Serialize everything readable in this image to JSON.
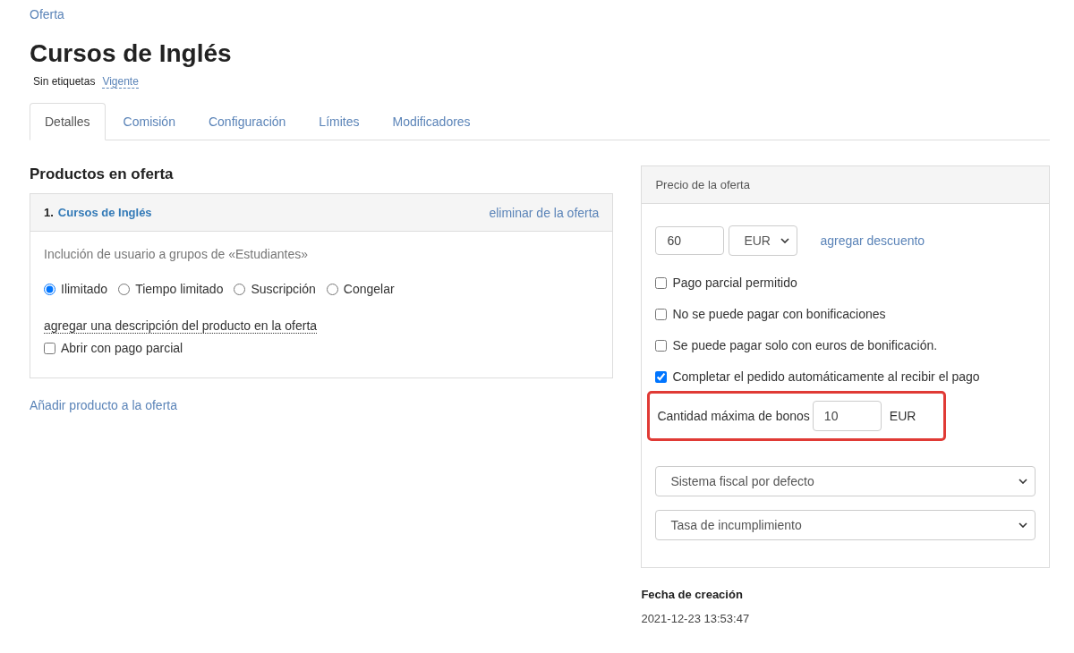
{
  "breadcrumb": "Oferta",
  "title": "Cursos de Inglés",
  "tags_label": "Sin etiquetas",
  "status": "Vigente",
  "tabs": [
    {
      "label": "Detalles",
      "selected": true
    },
    {
      "label": "Comisión",
      "selected": false
    },
    {
      "label": "Configuración",
      "selected": false
    },
    {
      "label": "Límites",
      "selected": false
    },
    {
      "label": "Modificadores",
      "selected": false
    }
  ],
  "products": {
    "heading": "Productos en oferta",
    "items": [
      {
        "number": "1.",
        "name": "Cursos de Inglés",
        "remove": "eliminar de la oferta",
        "description": "Inclución de usuario a grupos de «Estudiantes»",
        "access_options": [
          {
            "label": "Ilimitado",
            "selected": true
          },
          {
            "label": "Tiempo limitado",
            "selected": false
          },
          {
            "label": "Suscripción",
            "selected": false
          },
          {
            "label": "Congelar",
            "selected": false
          }
        ],
        "add_description": "agregar una descripción del producto en la oferta",
        "partial_open": {
          "label": "Abrir con pago parcial",
          "checked": false
        }
      }
    ],
    "add_product": "Añadir producto a la oferta"
  },
  "price": {
    "header": "Precio de la oferta",
    "amount": "60",
    "currency": "EUR",
    "discount_link": "agregar descuento",
    "options": [
      {
        "label": "Pago parcial permitido",
        "checked": false
      },
      {
        "label": "No se puede pagar con bonificaciones",
        "checked": false
      },
      {
        "label": "Se puede pagar solo con euros de bonificación.",
        "checked": false
      },
      {
        "label": "Completar el pedido automáticamente al recibir el pago",
        "checked": true
      }
    ],
    "max_bonus": {
      "label": "Cantidad máxima de bonos",
      "value": "10",
      "unit": "EUR",
      "highlighted": true
    },
    "tax_system": "Sistema fiscal por defecto",
    "default_rate": "Tasa de incumplimiento"
  },
  "created": {
    "label": "Fecha de creación",
    "value": "2021-12-23 13:53:47"
  }
}
